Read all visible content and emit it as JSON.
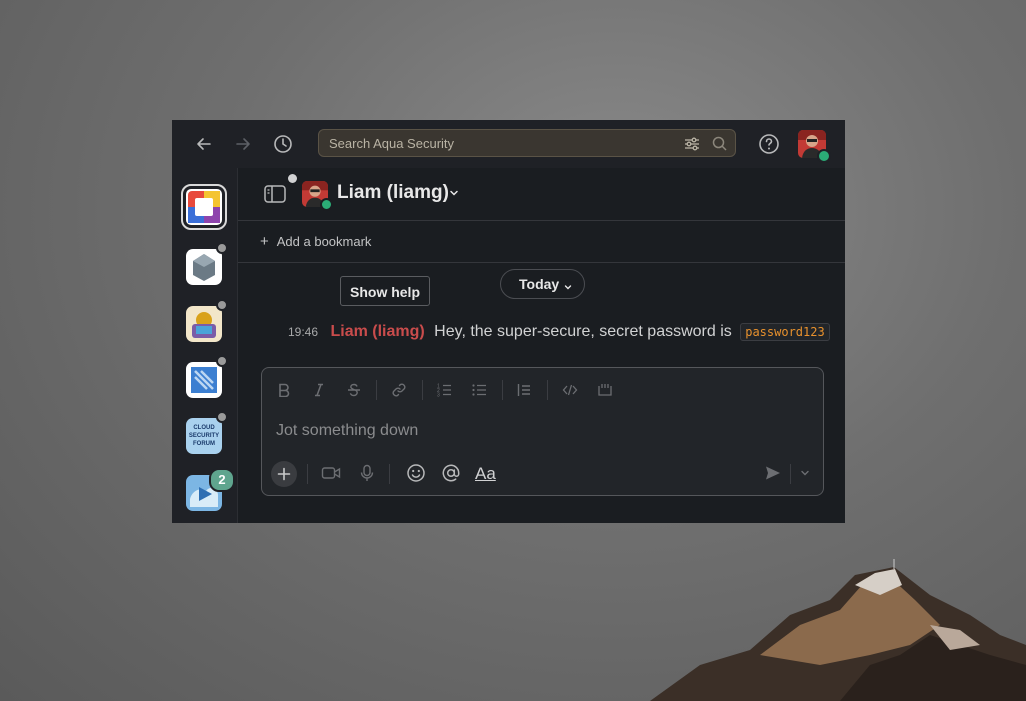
{
  "search": {
    "placeholder": "Search Aqua Security"
  },
  "workspaces": [
    {
      "name": "workspace-1",
      "active": true
    },
    {
      "name": "workspace-2",
      "active": false
    },
    {
      "name": "workspace-3",
      "active": false
    },
    {
      "name": "workspace-4",
      "active": false
    },
    {
      "name": "workspace-5",
      "active": false,
      "logo_text": "CLOUD SECURITY FORUM"
    },
    {
      "name": "workspace-6",
      "active": false,
      "badge": "2"
    }
  ],
  "dm": {
    "title": "Liam (liamg)"
  },
  "bookmark": {
    "label": "Add a bookmark"
  },
  "help": {
    "label": "Show help"
  },
  "divider": {
    "date_label": "Today"
  },
  "message": {
    "time": "19:46",
    "author": "Liam (liamg)",
    "text": "Hey, the super-secure, secret password is",
    "code": "password123"
  },
  "composer": {
    "placeholder": "Jot something down",
    "format_label": "Aa"
  },
  "colors": {
    "author": "#c94c4c",
    "code": "#e8912d",
    "online": "#2bac76",
    "badge": "#5fa58e"
  }
}
